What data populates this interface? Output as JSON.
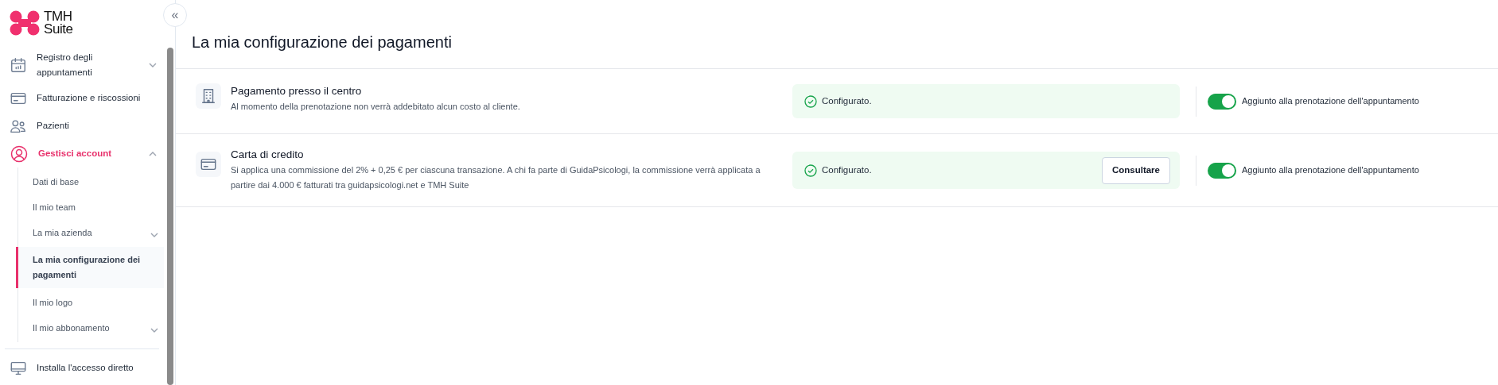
{
  "logo": {
    "line_1": "TMH",
    "line_2": "Suite"
  },
  "collapse_button": {
    "label": "«"
  },
  "sidebar": {
    "items": [
      {
        "label": "Registro degli appuntamenti",
        "expanded": false,
        "selected": false
      },
      {
        "label": "Fatturazione e riscossioni",
        "selected": false
      },
      {
        "label": "Pazienti",
        "selected": false
      },
      {
        "label": "Gestisci account",
        "expanded": true,
        "selected": true,
        "children": [
          {
            "label": "Dati di base",
            "selected": false
          },
          {
            "label": "Il mio team",
            "selected": false
          },
          {
            "label": "La mia azienda",
            "expanded": false,
            "selected": false
          },
          {
            "label": "La mia configurazione dei pagamenti",
            "selected": true
          },
          {
            "label": "Il mio logo",
            "selected": false
          },
          {
            "label": "Il mio abbonamento",
            "expanded": false,
            "selected": false
          }
        ]
      }
    ],
    "footer_items": [
      {
        "label": "Installa l'accesso diretto",
        "selected": false
      }
    ]
  },
  "page_title": "La mia configurazione dei pagamenti",
  "payment_methods": [
    {
      "title": "Pagamento presso il centro",
      "description": "Al momento della prenotazione non verrà addebitato alcun costo al cliente.",
      "status": "Configurato.",
      "configured": true,
      "toggle_label": "Aggiunto alla prenotazione dell'appuntamento",
      "on": true
    },
    {
      "title": "Carta di credito",
      "description": "Si applica una commissione del 2% + 0,25 € per ciascuna transazione. A chi fa parte di GuidaPsicologi, la commissione verrà applicata a partire dai 4.000 € fatturati tra guidapsicologi.net e TMH Suite",
      "status": "Configurato.",
      "configured": true,
      "button": "Consultare",
      "toggle_label": "Aggiunto alla prenotazione dell'appuntamento",
      "on": true
    }
  ]
}
